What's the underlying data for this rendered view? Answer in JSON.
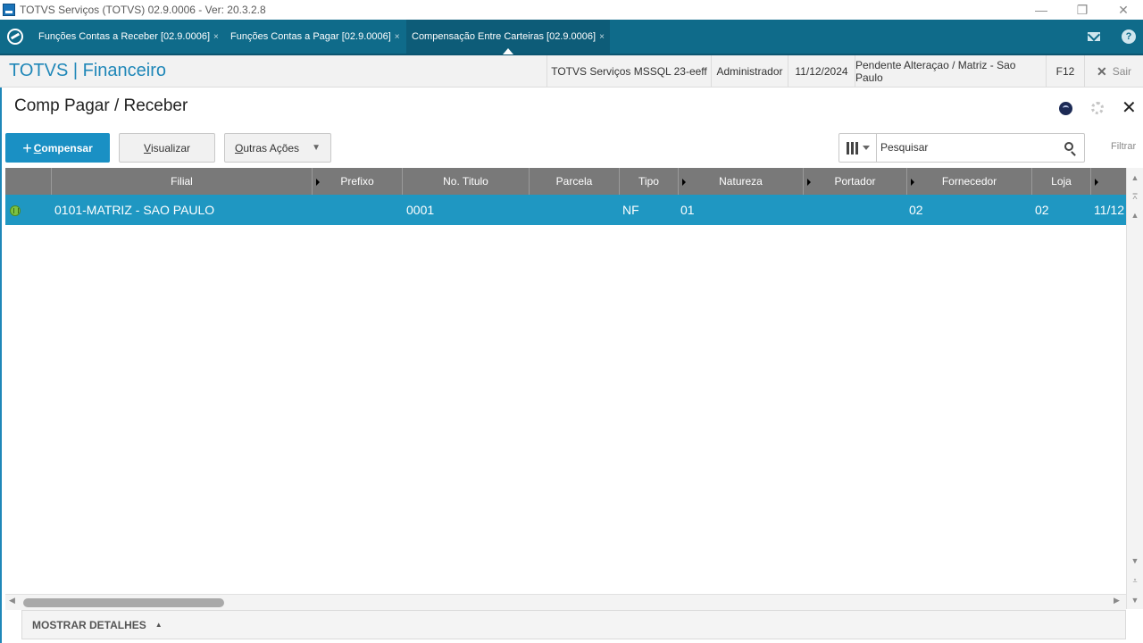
{
  "window": {
    "title": "TOTVS Serviços (TOTVS) 02.9.0006 - Ver: 20.3.2.8",
    "minimize": "—",
    "restore": "❐",
    "close": "✕"
  },
  "tabs": [
    {
      "label": "Funções Contas a Receber [02.9.0006]",
      "close": "×"
    },
    {
      "label": "Funções Contas a Pagar [02.9.0006]",
      "close": "×"
    },
    {
      "label": "Compensação Entre Carteiras [02.9.0006]",
      "close": "×"
    }
  ],
  "help_label": "?",
  "module": {
    "brand": "TOTVS | Financeiro",
    "server": "TOTVS Serviços MSSQL 23-eeff",
    "user": "Administrador",
    "date": "11/12/2024",
    "branch": "Pendente Alteraçao / Matriz - Sao Paulo",
    "shortcut": "F12",
    "exit_icon": "✕",
    "exit": "Sair"
  },
  "page": {
    "title": "Comp Pagar / Receber",
    "close": "✕"
  },
  "toolbar": {
    "primary_plus": "+",
    "primary_hotkey": "C",
    "primary_rest": "ompensar",
    "view_hotkey": "V",
    "view_rest": "isualizar",
    "more_hotkey": "O",
    "more_rest": "utras Ações",
    "more_caret": "▼"
  },
  "search": {
    "placeholder": "Pesquisar",
    "value": "Pesquisar",
    "filter": "Filtrar"
  },
  "grid": {
    "columns": [
      "Filial",
      "Prefixo",
      "No. Titulo",
      "Parcela",
      "Tipo",
      "Natureza",
      "Portador",
      "Fornecedor",
      "Loja"
    ],
    "rows": [
      {
        "filial": "0101-MATRIZ - SAO PAULO",
        "prefixo": "",
        "titulo": "0001",
        "parcela": "",
        "tipo": "NF",
        "natureza": "01",
        "portador": "",
        "fornecedor": "02",
        "loja": "02",
        "extra": "11/12"
      }
    ]
  },
  "scroll": {
    "up_top": "▲",
    "up_step": "⩞",
    "up_small": "▲",
    "down_small": "▼",
    "down_step": "⩡",
    "down_bottom": "▼",
    "left": "◀",
    "right": "▶"
  },
  "details": {
    "label": "MOSTRAR DETALHES",
    "arrow": "▲"
  }
}
